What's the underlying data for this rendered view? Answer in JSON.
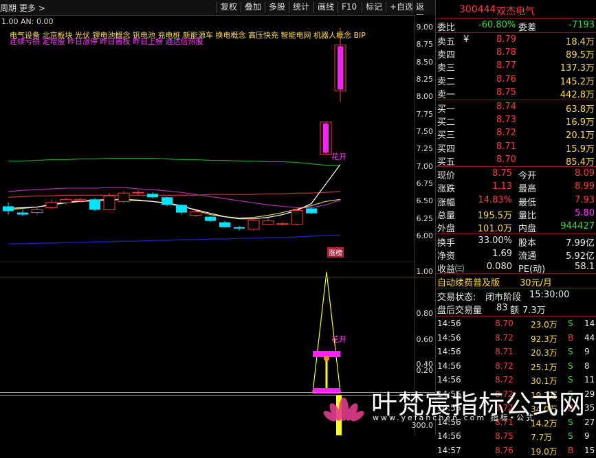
{
  "toolbar": {
    "left_label": "周期",
    "more_label": "更多 >",
    "buttons": [
      "复权",
      "叠加",
      "多股",
      "统计",
      "画线",
      "F10",
      "标记",
      "+自选",
      "返回"
    ]
  },
  "chart": {
    "info_line": "1.00  AN: 0.00",
    "concepts_line1": "电气设备  北京板块  光伏  锂电池概念  钒电池  充电桩  新能源车  换电概念  高压快充  智能电网  机器人概念  BIP",
    "concepts_line2": "连续亏损  定增股  昨日涨停  昨日首板  昨日上榜  通达信热股",
    "label_huakai": "花开",
    "label_huakai2": "花开",
    "label_zhangbang": "涨榜",
    "price_ticks": [
      "9.00",
      "8.75",
      "8.50",
      "8.25",
      "8.00",
      "7.75",
      "7.50",
      "7.25",
      "7.00",
      "6.75",
      "6.50",
      "6.25",
      "6.00"
    ],
    "ind_ticks": [
      "1.00",
      "0.80",
      "0.60",
      "0.40",
      "0.20",
      "300.0"
    ],
    "candles": [
      {
        "o": 6.43,
        "c": 6.36,
        "h": 6.49,
        "l": 6.31
      },
      {
        "o": 6.34,
        "c": 6.31,
        "h": 6.38,
        "l": 6.29
      },
      {
        "o": 6.34,
        "c": 6.38,
        "h": 6.42,
        "l": 6.31
      },
      {
        "o": 6.41,
        "c": 6.49,
        "h": 6.53,
        "l": 6.39
      },
      {
        "o": 6.48,
        "c": 6.53,
        "h": 6.55,
        "l": 6.45
      },
      {
        "o": 6.51,
        "c": 6.53,
        "h": 6.55,
        "l": 6.48
      },
      {
        "o": 6.53,
        "c": 6.38,
        "h": 6.55,
        "l": 6.36
      },
      {
        "o": 6.38,
        "c": 6.58,
        "h": 6.62,
        "l": 6.37
      },
      {
        "o": 6.5,
        "c": 6.62,
        "h": 6.65,
        "l": 6.47
      },
      {
        "o": 6.62,
        "c": 6.63,
        "h": 6.66,
        "l": 6.59
      },
      {
        "o": 6.61,
        "c": 6.56,
        "h": 6.63,
        "l": 6.54
      },
      {
        "o": 6.56,
        "c": 6.45,
        "h": 6.57,
        "l": 6.43
      },
      {
        "o": 6.45,
        "c": 6.34,
        "h": 6.46,
        "l": 6.31
      },
      {
        "o": 6.3,
        "c": 6.35,
        "h": 6.38,
        "l": 6.28
      },
      {
        "o": 6.28,
        "c": 6.22,
        "h": 6.29,
        "l": 6.2
      },
      {
        "o": 6.2,
        "c": 6.13,
        "h": 6.22,
        "l": 6.12
      },
      {
        "o": 6.13,
        "c": 6.11,
        "h": 6.15,
        "l": 6.08
      },
      {
        "o": 6.1,
        "c": 6.23,
        "h": 6.25,
        "l": 6.08
      },
      {
        "o": 6.17,
        "c": 6.22,
        "h": 6.26,
        "l": 6.16
      },
      {
        "o": 6.17,
        "c": 6.18,
        "h": 6.21,
        "l": 6.15
      },
      {
        "o": 6.17,
        "c": 6.37,
        "h": 6.39,
        "l": 6.15
      },
      {
        "o": 6.4,
        "c": 6.33,
        "h": 6.42,
        "l": 6.32
      },
      {
        "o": 7.18,
        "c": 7.64,
        "h": 7.64,
        "l": 7.18
      },
      {
        "o": 8.09,
        "c": 8.75,
        "h": 8.99,
        "l": 7.93
      }
    ],
    "ma_upper": [
      7.08,
      7.08,
      7.09,
      7.1,
      7.1,
      7.11,
      7.11,
      7.12,
      7.12,
      7.12,
      7.12,
      7.11,
      7.1,
      7.1,
      7.09,
      7.09,
      7.08,
      7.08,
      7.07,
      7.07,
      7.06,
      7.04,
      7.02,
      7.02
    ],
    "ma_mid": [
      6.64,
      6.66,
      6.67,
      6.68,
      6.69,
      6.69,
      6.69,
      6.7,
      6.7,
      6.68,
      6.67,
      6.65,
      6.63,
      6.6,
      6.57,
      6.54,
      6.51,
      6.48,
      6.45,
      6.43,
      6.41,
      6.41,
      6.45,
      6.52
    ],
    "ma_lower": [
      6.56,
      6.57,
      6.58,
      6.58,
      6.59,
      6.59,
      6.59,
      6.59,
      6.59,
      6.59,
      6.59,
      6.59,
      6.59,
      6.59,
      6.6,
      6.6,
      6.6,
      6.6,
      6.61,
      6.61,
      6.62,
      6.62,
      6.63,
      6.64
    ],
    "ma_yellow": [
      6.38,
      6.4,
      6.42,
      6.46,
      6.49,
      6.51,
      6.52,
      6.53,
      6.52,
      6.51,
      6.5,
      6.48,
      6.44,
      6.37,
      6.31,
      6.28,
      6.26,
      6.27,
      6.3,
      6.34,
      6.39,
      6.44,
      6.5,
      6.53
    ],
    "ma_white": [
      6.4,
      6.41,
      6.42,
      6.45,
      6.48,
      6.5,
      6.51,
      6.52,
      6.53,
      6.52,
      6.5,
      6.47,
      6.43,
      6.38,
      6.33,
      6.28,
      6.25,
      6.25,
      6.27,
      6.31,
      6.37,
      6.47,
      6.75,
      7.03
    ],
    "ma_blue": [
      5.89,
      5.89,
      5.9,
      5.9,
      5.91,
      5.91,
      5.92,
      5.92,
      5.93,
      5.93,
      5.94,
      5.94,
      5.95,
      5.95,
      5.96,
      5.96,
      5.97,
      5.97,
      5.98,
      5.98,
      5.99,
      6.0,
      6.01,
      6.01
    ]
  },
  "panel": {
    "code": "300444",
    "name": "双杰电气",
    "weibi_label": "委比",
    "weibi_val": "-60.80%",
    "weicha_label": "委差",
    "weicha_val": "-7193",
    "asks": [
      {
        "label": "卖五",
        "flag": "¥",
        "price": "8.79",
        "vol": "18.4万"
      },
      {
        "label": "卖四",
        "flag": "",
        "price": "8.78",
        "vol": "89.5万"
      },
      {
        "label": "卖三",
        "flag": "",
        "price": "8.77",
        "vol": "137.3万"
      },
      {
        "label": "卖二",
        "flag": "",
        "price": "8.76",
        "vol": "145.2万"
      },
      {
        "label": "卖一",
        "flag": "",
        "price": "8.75",
        "vol": "442.8万"
      }
    ],
    "bids": [
      {
        "label": "买一",
        "price": "8.74",
        "vol": "63.8万"
      },
      {
        "label": "买二",
        "price": "8.73",
        "vol": "16.9万"
      },
      {
        "label": "买三",
        "price": "8.72",
        "vol": "20.1万"
      },
      {
        "label": "买四",
        "price": "8.71",
        "vol": "15.9万"
      },
      {
        "label": "买五",
        "price": "8.70",
        "vol": "85.4万"
      }
    ],
    "stats": [
      {
        "l1": "现价",
        "v1": "8.75",
        "l2": "今开",
        "v2": "8.09",
        "c2": "red"
      },
      {
        "l1": "涨跌",
        "v1": "1.13",
        "l2": "最高",
        "v2": "8.99",
        "c2": "red"
      },
      {
        "l1": "涨幅",
        "v1": "14.83%",
        "l2": "最低",
        "v2": "7.93",
        "c2": "red"
      },
      {
        "l1": "总量",
        "v1": "195.5万",
        "l2": "量比",
        "v2": "5.80",
        "c2": "magenta"
      },
      {
        "l1": "外盘",
        "v1": "101.0万",
        "l2": "内盘",
        "v2": "944427",
        "c2": "green"
      }
    ],
    "stats2": [
      {
        "l1": "换手",
        "v1": "33.00%",
        "l2": "股本",
        "v2": "7.99亿"
      },
      {
        "l1": "净资",
        "v1": "1.69",
        "l2": "流通",
        "v2": "5.92亿"
      },
      {
        "l1": "收益㈢",
        "v1": "0.080",
        "l2": "PE(动)",
        "v2": "58.1"
      }
    ],
    "promo": "自动续费普及版",
    "promo_price": "30元/月",
    "trade_status_label": "交易状态:",
    "trade_status": "闭市阶段",
    "trade_time": "15:30:00",
    "after_label": "盘后交易量",
    "after_vol": "83",
    "after_amt_label": "额",
    "after_amt": "7.3万",
    "trades": [
      {
        "t": "14:56",
        "p": "8.70",
        "v": "23.0万",
        "s": "S",
        "n": "14"
      },
      {
        "t": "14:56",
        "p": "8.72",
        "v": "92.3万",
        "s": "B",
        "n": "44"
      },
      {
        "t": "14:56",
        "p": "8.71",
        "v": "20.3万",
        "s": "S",
        "n": "9"
      },
      {
        "t": "14:56",
        "p": "8.72",
        "v": "25.1万",
        "s": "S",
        "n": "8"
      },
      {
        "t": "14:56",
        "p": "8.72",
        "v": "30.1万",
        "s": "S",
        "n": "11"
      },
      {
        "t": "14:56",
        "p": "8.72",
        "v": "19.7万",
        "s": "S",
        "n": "29"
      },
      {
        "t": "14:56",
        "p": "8.72",
        "v": "34.0万",
        "s": "B",
        "n": "35"
      },
      {
        "t": "14:56",
        "p": "8.71",
        "v": "14.2万",
        "s": "S",
        "n": "27"
      },
      {
        "t": "14:56",
        "p": "8.75",
        "v": "7.7万",
        "s": "S",
        "n": "9"
      },
      {
        "t": "14:57",
        "p": "8.76",
        "v": "19.0万",
        "s": "B",
        "n": "15"
      }
    ]
  },
  "watermark": {
    "text": "叶梵宸指标公式网",
    "url": "www.yefanchen.com  指标•公式"
  },
  "colors": {
    "up": "#ff3b3b",
    "down": "#00e5ff",
    "ma_upper": "#1aa31a",
    "ma_mid": "#b12fb1",
    "ma_lower": "#c23a3a",
    "ma_yellow": "#e6d24a",
    "ma_white": "#ffffff",
    "ma_blue": "#2323d6",
    "magenta": "#ff1fff",
    "yellow": "#ffff00"
  }
}
